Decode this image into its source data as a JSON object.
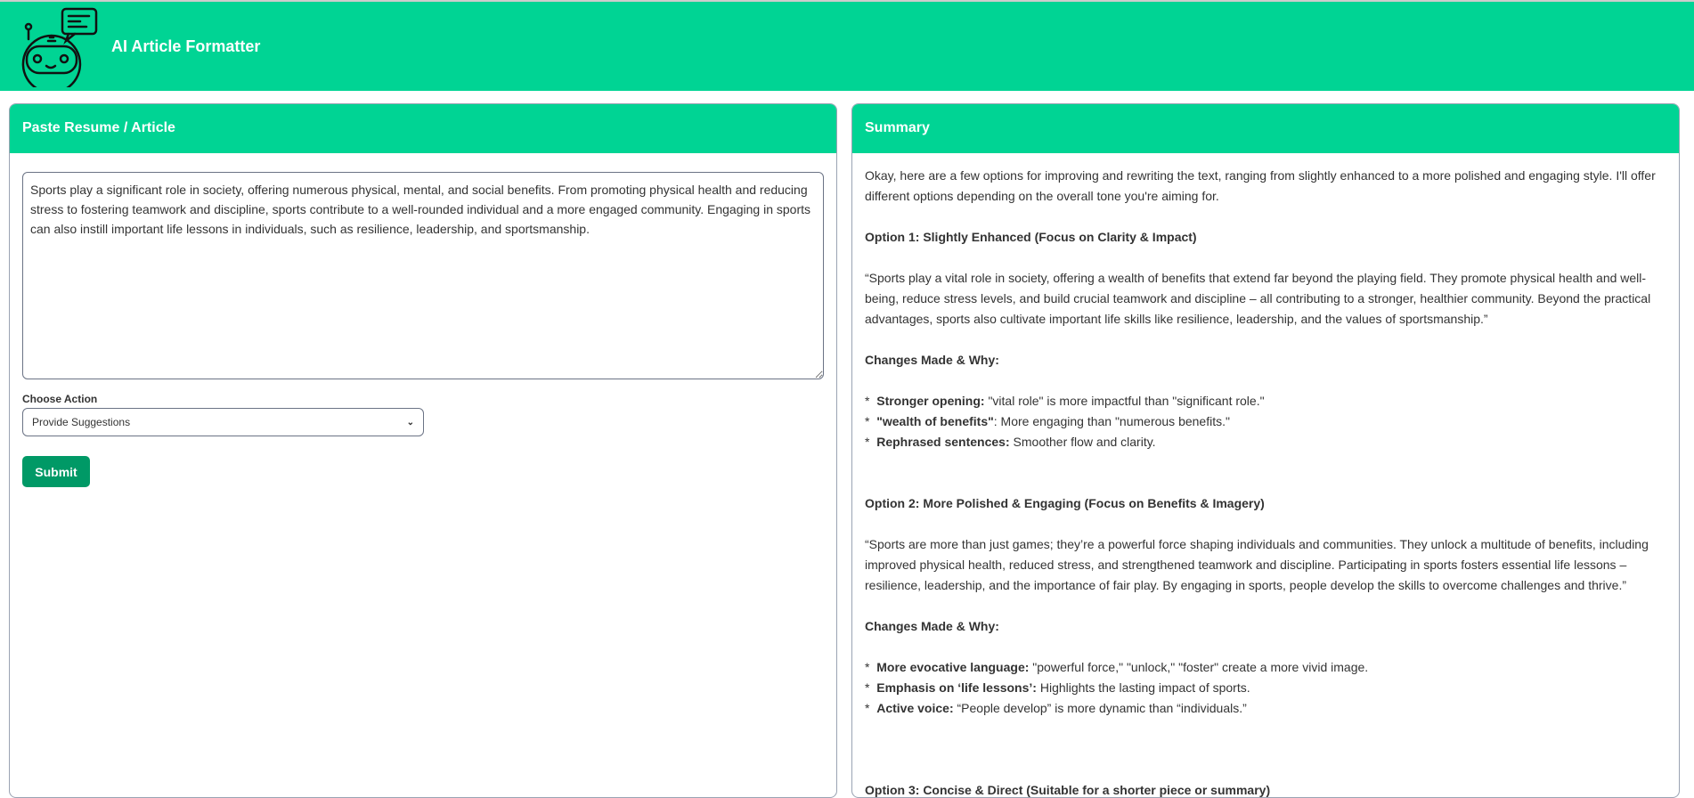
{
  "header": {
    "title": "AI Article Formatter",
    "logo": "robot-chat-icon",
    "color": "#00d494"
  },
  "left": {
    "title": "Paste Resume / Article",
    "article": "Sports play a significant role in society, offering numerous physical, mental, and social benefits. From promoting physical health and reducing stress to fostering teamwork and discipline, sports contribute to a well-rounded individual and a more engaged community. Engaging in sports can also instill important life lessons in individuals, such as resilience, leadership, and sportsmanship.",
    "action_label": "Choose Action",
    "action_value": "Provide Suggestions",
    "submit": "Submit"
  },
  "right": {
    "title": "Summary",
    "intro": "Okay, here are a few options for improving and rewriting the text, ranging from slightly enhanced to a more polished and engaging style. I'll offer different options depending on the overall tone you're aiming for.",
    "options": [
      {
        "heading": "Option 1: Slightly Enhanced (Focus on Clarity & Impact)",
        "text": "“Sports play a vital role in society, offering a wealth of benefits that extend far beyond the playing field. They promote physical health and well-being, reduce stress levels, and build crucial teamwork and discipline – all contributing to a stronger, healthier community. Beyond the practical advantages, sports also cultivate important life skills like resilience, leadership, and the values of sportsmanship.”",
        "changes_heading": "Changes Made & Why:",
        "changes": [
          {
            "bold": "Stronger opening:",
            "text": " \"vital role\" is more impactful than \"significant role.\""
          },
          {
            "bold": "\"wealth of benefits\"",
            "text": ":  More engaging than \"numerous benefits.\""
          },
          {
            "bold": "Rephrased sentences:",
            "text": " Smoother flow and clarity."
          }
        ]
      },
      {
        "heading": "Option 2: More Polished & Engaging (Focus on Benefits & Imagery)",
        "text": "“Sports are more than just games; they’re a powerful force shaping individuals and communities.  They unlock a multitude of benefits, including improved physical health, reduced stress, and strengthened teamwork and discipline.  Participating in sports fosters essential life lessons – resilience, leadership, and the importance of fair play.  By engaging in sports, people develop the skills to overcome challenges and thrive.”",
        "changes_heading": "Changes Made & Why:",
        "changes": [
          {
            "bold": "More evocative language:",
            "text": " \"powerful force,\" \"unlock,\" \"foster\" create a more vivid image."
          },
          {
            "bold": "Emphasis on ‘life lessons’:",
            "text": "  Highlights the lasting impact of sports."
          },
          {
            "bold": "Active voice:",
            "text": " “People develop” is more dynamic than “individuals.”"
          }
        ]
      },
      {
        "heading": "Option 3: Concise & Direct (Suitable for a shorter piece or summary)"
      }
    ]
  }
}
